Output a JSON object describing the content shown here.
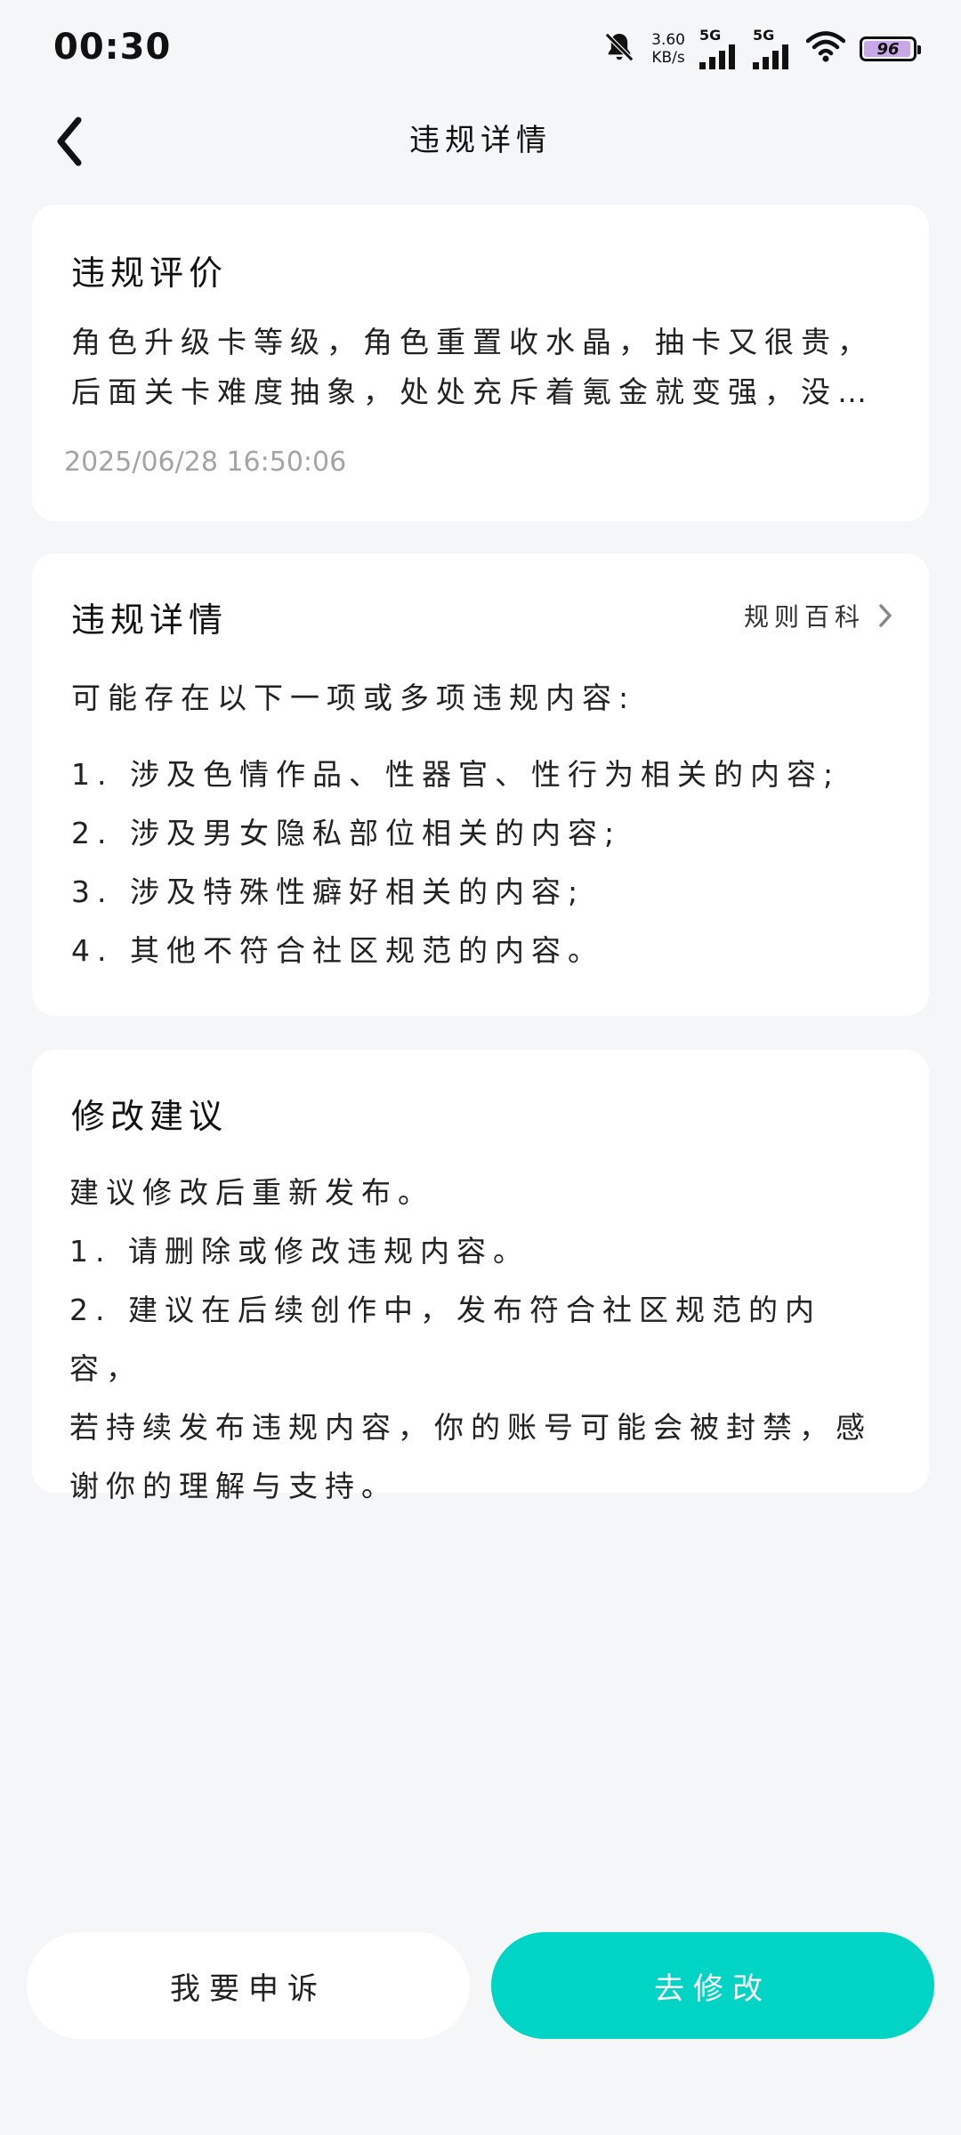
{
  "status_bar": {
    "time": "00:30",
    "net_speed_value": "3.60",
    "net_speed_unit": "KB/s",
    "signal1_label": "5G",
    "signal2_label": "5G",
    "battery": "96",
    "battery_level": 0.96
  },
  "header": {
    "title": "违规详情"
  },
  "review": {
    "title": "违规评价",
    "line1": "角色升级卡等级，角色重置收水晶，抽卡又很贵，",
    "line2": "后面关卡难度抽象，处处充斥着氪金就变强，没…",
    "timestamp": "2025/06/28 16:50:06"
  },
  "detail": {
    "title": "违规详情",
    "rules_link": "规则百科",
    "intro": "可能存在以下一项或多项违规内容:",
    "items": [
      "1. 涉及色情作品、性器官、性行为相关的内容;",
      "2. 涉及男女隐私部位相关的内容;",
      "3. 涉及特殊性癖好相关的内容;",
      "4. 其他不符合社区规范的内容。"
    ]
  },
  "suggestion": {
    "title": "修改建议",
    "lines": [
      "建议修改后重新发布。",
      "1. 请删除或修改违规内容。",
      "2. 建议在后续创作中，发布符合社区规范的内容，",
      "若持续发布违规内容，你的账号可能会被封禁，感",
      "谢你的理解与支持。"
    ]
  },
  "buttons": {
    "appeal": "我要申诉",
    "fix": "去修改"
  },
  "colors": {
    "background": "#f5f6f8",
    "card": "#ffffff",
    "accent": "#00d4c5",
    "timestamp": "#a4a4a4",
    "battery_fill": "#c8a7e6"
  }
}
